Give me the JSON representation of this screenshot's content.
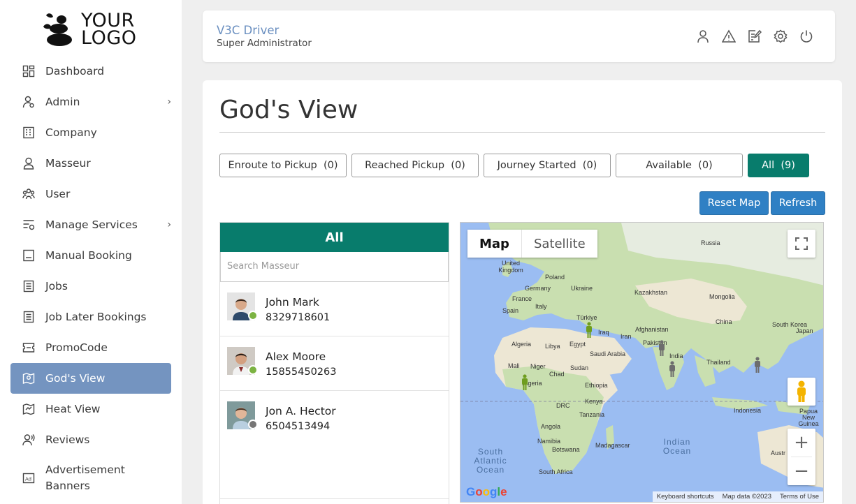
{
  "logo": {
    "line1": "YOUR",
    "line2": "LOGO"
  },
  "sidebar": {
    "items": [
      {
        "label": "Dashboard",
        "icon": "dashboard-icon"
      },
      {
        "label": "Admin",
        "icon": "admin-icon",
        "has_submenu": true
      },
      {
        "label": "Company",
        "icon": "company-icon"
      },
      {
        "label": "Masseur",
        "icon": "masseur-icon"
      },
      {
        "label": "User",
        "icon": "user-icon"
      },
      {
        "label": "Manage Services",
        "icon": "manage-services-icon",
        "has_submenu": true
      },
      {
        "label": "Manual Booking",
        "icon": "manual-booking-icon"
      },
      {
        "label": "Jobs",
        "icon": "jobs-icon"
      },
      {
        "label": "Job Later Bookings",
        "icon": "job-later-icon"
      },
      {
        "label": "PromoCode",
        "icon": "promocode-icon"
      },
      {
        "label": "God's View",
        "icon": "gods-view-icon",
        "active": true
      },
      {
        "label": "Heat View",
        "icon": "heat-view-icon"
      },
      {
        "label": "Reviews",
        "icon": "reviews-icon"
      },
      {
        "label": "Advertisement Banners",
        "icon": "ad-icon"
      }
    ],
    "chevron": "›"
  },
  "header": {
    "title": "V3C Driver",
    "subtitle": "Super Administrator",
    "icons": [
      "profile-icon",
      "alert-icon",
      "edit-icon",
      "settings-icon",
      "power-icon"
    ]
  },
  "main": {
    "title": "God's View",
    "filters": [
      {
        "label": "Enroute to Pickup",
        "count": "(0)"
      },
      {
        "label": "Reached Pickup",
        "count": "(0)"
      },
      {
        "label": "Journey Started",
        "count": "(0)"
      },
      {
        "label": "Available",
        "count": "(0)"
      },
      {
        "label": "All",
        "count": "(9)",
        "active": true
      }
    ],
    "reset_map": "Reset Map",
    "refresh": "Refresh"
  },
  "list": {
    "header": "All",
    "search_placeholder": "Search Masseur",
    "masseurs": [
      {
        "name": "John Mark",
        "phone": "8329718601",
        "status_color": "#7cb342"
      },
      {
        "name": "Alex Moore",
        "phone": "15855450263",
        "status_color": "#7cb342"
      },
      {
        "name": "Jon A. Hector",
        "phone": "6504513494",
        "status_color": "#757575"
      }
    ]
  },
  "map": {
    "types": [
      "Map",
      "Satellite"
    ],
    "selected_type": "Map",
    "footer": [
      "Keyboard shortcuts",
      "Map data ©2023",
      "Terms of Use"
    ],
    "labels": {
      "russia": "Russia",
      "uk": "United Kingdom",
      "poland": "Poland",
      "germany": "Germany",
      "ukraine": "Ukraine",
      "france": "France",
      "italy": "Italy",
      "spain": "Spain",
      "kazakhstan": "Kazakhstan",
      "mongolia": "Mongolia",
      "turkiye": "Türkiye",
      "china": "China",
      "south_korea": "South Korea",
      "japan": "Japan",
      "afghanistan": "Afghanistan",
      "iraq": "Iraq",
      "iran": "Iran",
      "pakistan": "Pakistan",
      "algeria": "Algeria",
      "libya": "Libya",
      "egypt": "Egypt",
      "saudi": "Saudi Arabia",
      "india": "India",
      "thailand": "Thailand",
      "mali": "Mali",
      "niger": "Niger",
      "sudan": "Sudan",
      "chad": "Chad",
      "nigeria": "Nigeria",
      "ethiopia": "Ethiopia",
      "drc": "DRC",
      "kenya": "Kenya",
      "tanzania": "Tanzania",
      "indonesia": "Indonesia",
      "png": "Papua New Guinea",
      "angola": "Angola",
      "namibia": "Namibia",
      "botswana": "Botswana",
      "madagascar": "Madagascar",
      "south_africa": "South Africa",
      "australia": "Austr",
      "south_atlantic": "South Atlantic Ocean",
      "indian_ocean": "Indian Ocean"
    }
  }
}
